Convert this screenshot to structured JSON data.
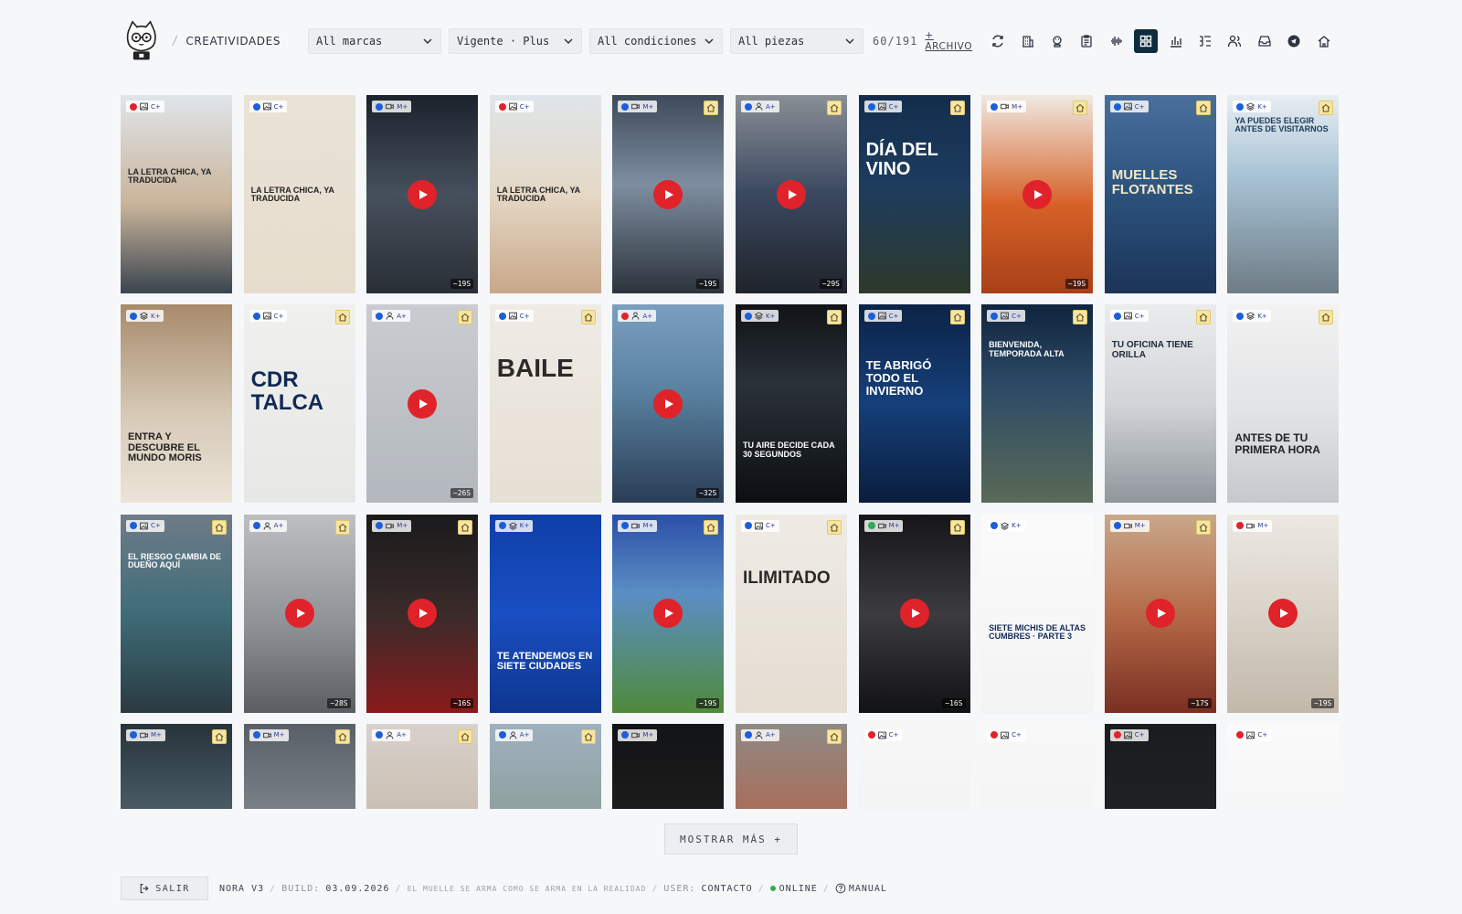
{
  "header": {
    "section": "CREATIVIDADES",
    "filters": [
      {
        "label": "All marcas",
        "width": 146
      },
      {
        "label": "Vigente · Plus",
        "width": 146
      },
      {
        "label": "All condiciones",
        "width": 146
      },
      {
        "label": "All piezas",
        "width": 146
      }
    ],
    "count": "60/191",
    "archive": "+ ARCHIVO",
    "tools": [
      "refresh-icon",
      "building-icon",
      "chef-icon",
      "clipboard-icon",
      "waveform-icon",
      "grid-icon",
      "bar-chart-icon",
      "list-icon",
      "users-icon",
      "inbox-icon",
      "telegram-icon",
      "home-icon"
    ],
    "active_tool": 5
  },
  "cards": [
    {
      "bg": "linear-gradient(180deg,#dfe5ea 0%,#c9b49a 55%,#3a4450 100%)",
      "dot": "#e0232a",
      "icon": "image",
      "lvl": "C+",
      "home": false,
      "text": "LA LETRA CHICA, YA TRADUCIDA",
      "tcolor": "#222",
      "tpos": 80
    },
    {
      "bg": "linear-gradient(180deg,#e9e2d6 0%,#e7ddcd 100%)",
      "dot": "#1d5fd8",
      "icon": "image",
      "lvl": "C+",
      "home": false,
      "text": "LA LETRA CHICA, YA TRADUCIDA",
      "tcolor": "#222",
      "tpos": 100
    },
    {
      "bg": "linear-gradient(180deg,#1a222c 0%,#46505c 50%,#2a2f36 100%)",
      "dot": "#1d5fd8",
      "icon": "video",
      "lvl": "M+",
      "home": false,
      "play": true,
      "dur": "~19S"
    },
    {
      "bg": "linear-gradient(180deg,#dfe5ea 0%,#e5d8c5 50%,#c8a78a 100%)",
      "dot": "#e0232a",
      "icon": "image",
      "lvl": "C+",
      "home": false,
      "text": "LA LETRA CHICA, YA TRADUCIDA",
      "tcolor": "#222",
      "tpos": 100
    },
    {
      "bg": "linear-gradient(180deg,#3d4a5a 0%,#7e8ea0 45%,#2c333c 100%)",
      "dot": "#1d5fd8",
      "icon": "video",
      "lvl": "M+",
      "home": true,
      "play": true,
      "dur": "~19S"
    },
    {
      "bg": "linear-gradient(180deg,#8a8f95 0%,#3a4860 50%,#20242a 100%)",
      "dot": "#1d5fd8",
      "icon": "person",
      "lvl": "A+",
      "home": true,
      "play": true,
      "dur": "~29S"
    },
    {
      "bg": "linear-gradient(180deg,#142d4c 0%,#1d3c5e 45%,#2e3a2a 100%)",
      "dot": "#1d5fd8",
      "icon": "image",
      "lvl": "C+",
      "home": true,
      "text": "DÍA DEL VINO",
      "tcolor": "#fff",
      "tpos": 50,
      "tsize": 20
    },
    {
      "bg": "linear-gradient(180deg,#efeae3 0%,#d76228 55%,#a84018 100%)",
      "dot": "#1d5fd8",
      "icon": "video",
      "lvl": "M+",
      "home": true,
      "play": true,
      "dur": "~19S"
    },
    {
      "bg": "linear-gradient(180deg,#4b6f9c 0%,#2d5580 45%,#1c3458 100%)",
      "dot": "#1d5fd8",
      "icon": "image",
      "lvl": "C+",
      "home": true,
      "text": "MUELLES FLOTANTES",
      "tcolor": "#f2e6c8",
      "tpos": 80,
      "tsize": 15
    },
    {
      "bg": "linear-gradient(180deg,#e8eef2 0%,#a9c4d6 40%,#6e7c86 100%)",
      "dot": "#1d5fd8",
      "icon": "layers",
      "lvl": "K+",
      "home": true,
      "text": "YA PUEDES ELEGIR ANTES DE VISITARNOS",
      "tcolor": "#1c3a5a",
      "tpos": 24,
      "tsize": 9
    },
    {
      "bg": "linear-gradient(180deg,#a78a6c 0%,#d6c9b6 55%,#ece4d8 100%)",
      "dot": "#1d5fd8",
      "icon": "layers",
      "lvl": "K+",
      "home": false,
      "text": "ENTRA Y DESCUBRE EL MUNDO MORIS",
      "tcolor": "#222",
      "tpos": 140,
      "tsize": 11
    },
    {
      "bg": "linear-gradient(180deg,#f0f0ee 0%,#e7e8e6 100%)",
      "dot": "#1d5fd8",
      "icon": "image",
      "lvl": "C+",
      "home": true,
      "text": "CDR TALCA",
      "tcolor": "#112a55",
      "tpos": 70,
      "tsize": 24
    },
    {
      "bg": "linear-gradient(180deg,#c9ccd0 0%,#b3b8be 100%)",
      "dot": "#1d5fd8",
      "icon": "person",
      "lvl": "A+",
      "home": true,
      "play": true,
      "dur": "~26S"
    },
    {
      "bg": "linear-gradient(180deg,#efebe5 0%,#e6dfd4 100%)",
      "dot": "#1d5fd8",
      "icon": "image",
      "lvl": "C+",
      "home": true,
      "text": "BAILE",
      "tcolor": "#2a2a2a",
      "tpos": 55,
      "tsize": 28
    },
    {
      "bg": "linear-gradient(180deg,#7c9fbf 0%,#58809f 45%,#2a3d55 100%)",
      "dot": "#e0232a",
      "icon": "person",
      "lvl": "A+",
      "home": false,
      "play": true,
      "dur": "~32S"
    },
    {
      "bg": "linear-gradient(180deg,#101317 0%,#2a3138 40%,#0c0f12 100%)",
      "dot": "#1d5fd8",
      "icon": "layers",
      "lvl": "K+",
      "home": true,
      "text": "TU AIRE DECIDE CADA 30 SEGUNDOS",
      "tcolor": "#fff",
      "tpos": 150,
      "tsize": 9
    },
    {
      "bg": "linear-gradient(180deg,#0c2346 0%,#16407a 50%,#0a1d3c 100%)",
      "dot": "#1d5fd8",
      "icon": "image",
      "lvl": "C+",
      "home": true,
      "text": "TE ABRIGÓ TODO EL INVIERNO",
      "tcolor": "#fff",
      "tpos": 60,
      "tsize": 13
    },
    {
      "bg": "linear-gradient(180deg,#10243c 0%,#2c4a66 40%,#5a6a58 100%)",
      "dot": "#1d5fd8",
      "icon": "image",
      "lvl": "C+",
      "home": true,
      "text": "BIENVENIDA, TEMPORADA ALTA",
      "tcolor": "#fff",
      "tpos": 40,
      "tsize": 9
    },
    {
      "bg": "linear-gradient(180deg,#ebeced 0%,#d2d5d8 50%,#8f969c 100%)",
      "dot": "#1d5fd8",
      "icon": "image",
      "lvl": "C+",
      "home": true,
      "text": "TU OFICINA TIENE ORILLA",
      "tcolor": "#1c2a3a",
      "tpos": 40,
      "tsize": 10
    },
    {
      "bg": "linear-gradient(180deg,#f2f2f2 0%,#e2e3e5 55%,#c5c8cc 100%)",
      "dot": "#1d5fd8",
      "icon": "layers",
      "lvl": "K+",
      "home": true,
      "text": "ANTES DE TU PRIMERA HORA",
      "tcolor": "#222",
      "tpos": 140,
      "tsize": 12
    },
    {
      "bg": "linear-gradient(180deg,#6e7c88 0%,#3f6c78 50%,#2a3a40 100%)",
      "dot": "#1d5fd8",
      "icon": "image",
      "lvl": "C+",
      "home": true,
      "text": "EL RIESGO CAMBIA DE DUEÑO AQUÍ",
      "tcolor": "#fff",
      "tpos": 42,
      "tsize": 9
    },
    {
      "bg": "linear-gradient(180deg,#bdbfc1 0%,#8f9296 55%,#5a5e62 100%)",
      "dot": "#1d5fd8",
      "icon": "person",
      "lvl": "A+",
      "home": true,
      "play": true,
      "dur": "~28S"
    },
    {
      "bg": "linear-gradient(180deg,#1a1a1c 0%,#3a2b2a 50%,#8a1a1c 100%)",
      "dot": "#1d5fd8",
      "icon": "video",
      "lvl": "M+",
      "home": true,
      "play": true,
      "dur": "~16S"
    },
    {
      "bg": "linear-gradient(180deg,#0f3fa8 0%,#1a4fc3 50%,#0d368e 100%)",
      "dot": "#1d5fd8",
      "icon": "layers",
      "lvl": "K+",
      "home": false,
      "text": "TE ATENDEMOS EN SIETE CIUDADES",
      "tcolor": "#fff",
      "tpos": 150,
      "tsize": 11
    },
    {
      "bg": "linear-gradient(180deg,#2b4fa8 0%,#5b8ec3 40%,#4f8a3a 100%)",
      "dot": "#1d5fd8",
      "icon": "video",
      "lvl": "M+",
      "home": true,
      "play": true,
      "dur": "~19S"
    },
    {
      "bg": "linear-gradient(180deg,#efebe4 0%,#e4ddd2 100%)",
      "dot": "#1d5fd8",
      "icon": "image",
      "lvl": "C+",
      "home": true,
      "text": "ILIMITADO",
      "tcolor": "#2a2a2a",
      "tpos": 60,
      "tsize": 19
    },
    {
      "bg": "linear-gradient(180deg,#161618 0%,#3c3c40 50%,#121214 100%)",
      "dot": "#2faa55",
      "icon": "video",
      "lvl": "M+",
      "home": true,
      "play": true,
      "dur": "~16S"
    },
    {
      "bg": "linear-gradient(180deg,#fbfbfb 0%,#f3f3f3 100%)",
      "dot": "#1d5fd8",
      "icon": "layers",
      "lvl": "K+",
      "home": false,
      "text": "SIETE MICHIS DE ALTAS CUMBRES · PARTE 3",
      "tcolor": "#122a5a",
      "tpos": 120,
      "tsize": 9
    },
    {
      "bg": "linear-gradient(180deg,#c8a88a 0%,#b56a48 50%,#7a2f22 100%)",
      "dot": "#1d5fd8",
      "icon": "video",
      "lvl": "M+",
      "home": true,
      "play": true,
      "dur": "~17S"
    },
    {
      "bg": "linear-gradient(180deg,#ece8e2 0%,#d9d2c8 50%,#c2b8aa 100%)",
      "dot": "#e0232a",
      "icon": "video",
      "lvl": "M+",
      "home": false,
      "play": true,
      "dur": "~19S"
    },
    {
      "bg": "linear-gradient(180deg,#27343c 0%,#566a72 60%,#8b979c 100%)",
      "dot": "#1d5fd8",
      "icon": "video",
      "lvl": "M+",
      "home": true
    },
    {
      "bg": "linear-gradient(180deg,#5a6068 0%,#868c92 60%,#a8adb2 100%)",
      "dot": "#1d5fd8",
      "icon": "video",
      "lvl": "M+",
      "home": true
    },
    {
      "bg": "linear-gradient(180deg,#d8d2cb 0%,#b9a796 100%)",
      "dot": "#1d5fd8",
      "icon": "person",
      "lvl": "A+",
      "home": true
    },
    {
      "bg": "linear-gradient(180deg,#9fb0bf 0%,#7d8d78 100%)",
      "dot": "#1d5fd8",
      "icon": "person",
      "lvl": "A+",
      "home": true
    },
    {
      "bg": "linear-gradient(180deg,#121315 0%,#2a2826 100%)",
      "dot": "#1d5fd8",
      "icon": "video",
      "lvl": "M+",
      "home": false
    },
    {
      "bg": "linear-gradient(180deg,#8f8a84 0%,#c74a2a 100%)",
      "dot": "#1d5fd8",
      "icon": "person",
      "lvl": "A+",
      "home": true
    },
    {
      "bg": "linear-gradient(180deg,#f7f7f7 0%,#efefef 100%)",
      "dot": "#e0232a",
      "icon": "image",
      "lvl": "C+",
      "home": false
    },
    {
      "bg": "linear-gradient(180deg,#f8f8f8 0%,#f0f0f0 100%)",
      "dot": "#e0232a",
      "icon": "image",
      "lvl": "C+",
      "home": false
    },
    {
      "bg": "linear-gradient(180deg,#1a1c1f 0%,#24272b 100%)",
      "dot": "#e0232a",
      "icon": "image",
      "lvl": "C+",
      "home": false
    },
    {
      "bg": "linear-gradient(180deg,#fafafa 0%,#f2f2f2 100%)",
      "dot": "#e0232a",
      "icon": "image",
      "lvl": "C+",
      "home": false
    }
  ],
  "more_button": "MOSTRAR MÁS +",
  "footer": {
    "logout": "SALIR",
    "version": "NORA V3",
    "build_label": "BUILD:",
    "build_date": "03.09.2026",
    "tagline": "EL MUELLE SE ARMA COMO SE ARMA EN LA REALIDAD",
    "user_label": "USER:",
    "user": "CONTACTO",
    "status": "ONLINE",
    "manual": "MANUAL"
  }
}
